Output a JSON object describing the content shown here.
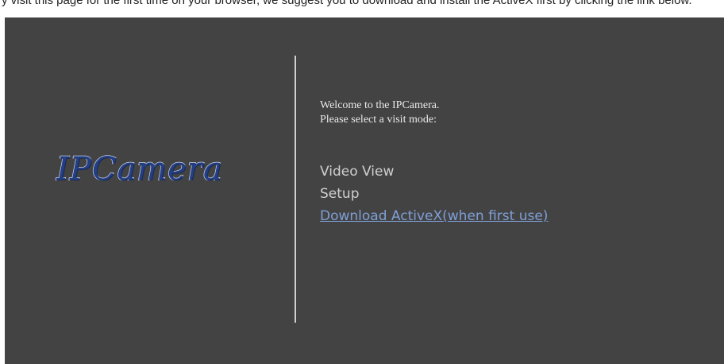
{
  "top_strip_text": "y visit this page for the first time on your browser, we suggest you to download and install the ActiveX first by clicking the link below.",
  "logo_text": "IPCamera",
  "welcome": {
    "line1": "Welcome to the IPCamera.",
    "line2": "Please select a visit mode:"
  },
  "menu": {
    "video_view": "Video View",
    "setup": "Setup",
    "download": "Download ActiveX(when first use)"
  },
  "colors": {
    "panel_bg": "#434343",
    "logo": "#233f86",
    "link": "#7f9fd6",
    "menu_text": "#cfcfcf"
  }
}
